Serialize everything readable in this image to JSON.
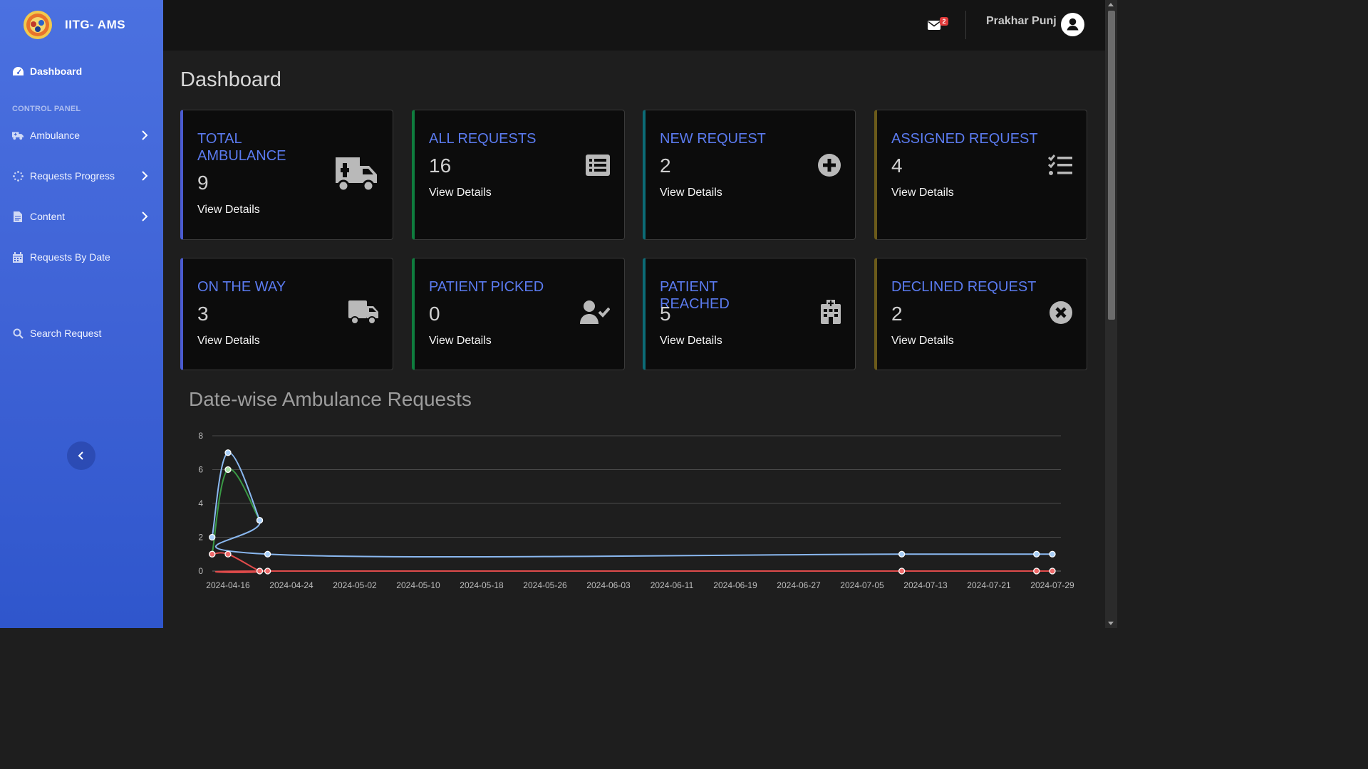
{
  "app": {
    "name": "IITG- AMS"
  },
  "sidebar": {
    "section_label": "CONTROL PANEL",
    "items": [
      {
        "label": "Dashboard",
        "icon": "gauge-icon"
      },
      {
        "label": "Ambulance",
        "icon": "ambulance-icon"
      },
      {
        "label": "Requests Progress",
        "icon": "spinner-icon"
      },
      {
        "label": "Content",
        "icon": "file-icon"
      },
      {
        "label": "Requests By Date",
        "icon": "calendar-icon"
      },
      {
        "label": "Search Request",
        "icon": "search-icon"
      }
    ]
  },
  "header": {
    "mail_count": "2",
    "user_name": "Prakhar Punj"
  },
  "page": {
    "title": "Dashboard"
  },
  "cards": [
    {
      "title": "TOTAL AMBULANCE",
      "count": "9",
      "link": "View Details",
      "icon": "ambulance-icon"
    },
    {
      "title": "ALL REQUESTS",
      "count": "16",
      "link": "View Details",
      "icon": "list-icon"
    },
    {
      "title": "NEW REQUEST",
      "count": "2",
      "link": "View Details",
      "icon": "plus-circle-icon"
    },
    {
      "title": "ASSIGNED REQUEST",
      "count": "4",
      "link": "View Details",
      "icon": "checklist-icon"
    },
    {
      "title": "ON THE WAY",
      "count": "3",
      "link": "View Details",
      "icon": "truck-icon"
    },
    {
      "title": "PATIENT PICKED",
      "count": "0",
      "link": "View Details",
      "icon": "user-check-icon"
    },
    {
      "title": "PATIENT REACHED",
      "count": "5",
      "link": "View Details",
      "icon": "hospital-icon"
    },
    {
      "title": "DECLINED REQUEST",
      "count": "2",
      "link": "View Details",
      "icon": "x-circle-icon"
    }
  ],
  "colors": {
    "accent": "#5b7bf0",
    "sidebar": "#3f63d6",
    "series_blue": "#8ab8f0",
    "series_green": "#3a9a45",
    "series_red": "#e04b4b"
  },
  "chart_data": {
    "type": "line",
    "title": "Date-wise Ambulance Requests",
    "xlabel": "",
    "ylabel": "",
    "ylim": [
      0,
      8
    ],
    "yticks": [
      0,
      2,
      4,
      6,
      8
    ],
    "xticks": [
      "2024-04-16",
      "2024-04-24",
      "2024-05-02",
      "2024-05-10",
      "2024-05-18",
      "2024-05-26",
      "2024-06-03",
      "2024-06-11",
      "2024-06-19",
      "2024-06-27",
      "2024-07-05",
      "2024-07-13",
      "2024-07-21",
      "2024-07-29"
    ],
    "grid": true,
    "series": [
      {
        "x": [
          "2024-04-14",
          "2024-04-16",
          "2024-04-20",
          "2024-04-21",
          "2024-07-10",
          "2024-07-27",
          "2024-07-29"
        ],
        "values": [
          2,
          7,
          3,
          1,
          1,
          1,
          1
        ]
      },
      {
        "x": [
          "2024-04-14",
          "2024-04-16",
          "2024-04-20"
        ],
        "values": [
          1,
          6,
          3
        ]
      },
      {
        "x": [
          "2024-04-14",
          "2024-04-16",
          "2024-04-20",
          "2024-04-21",
          "2024-07-10",
          "2024-07-27",
          "2024-07-29"
        ],
        "values": [
          1,
          1,
          0,
          0,
          0,
          0,
          0
        ]
      }
    ]
  }
}
